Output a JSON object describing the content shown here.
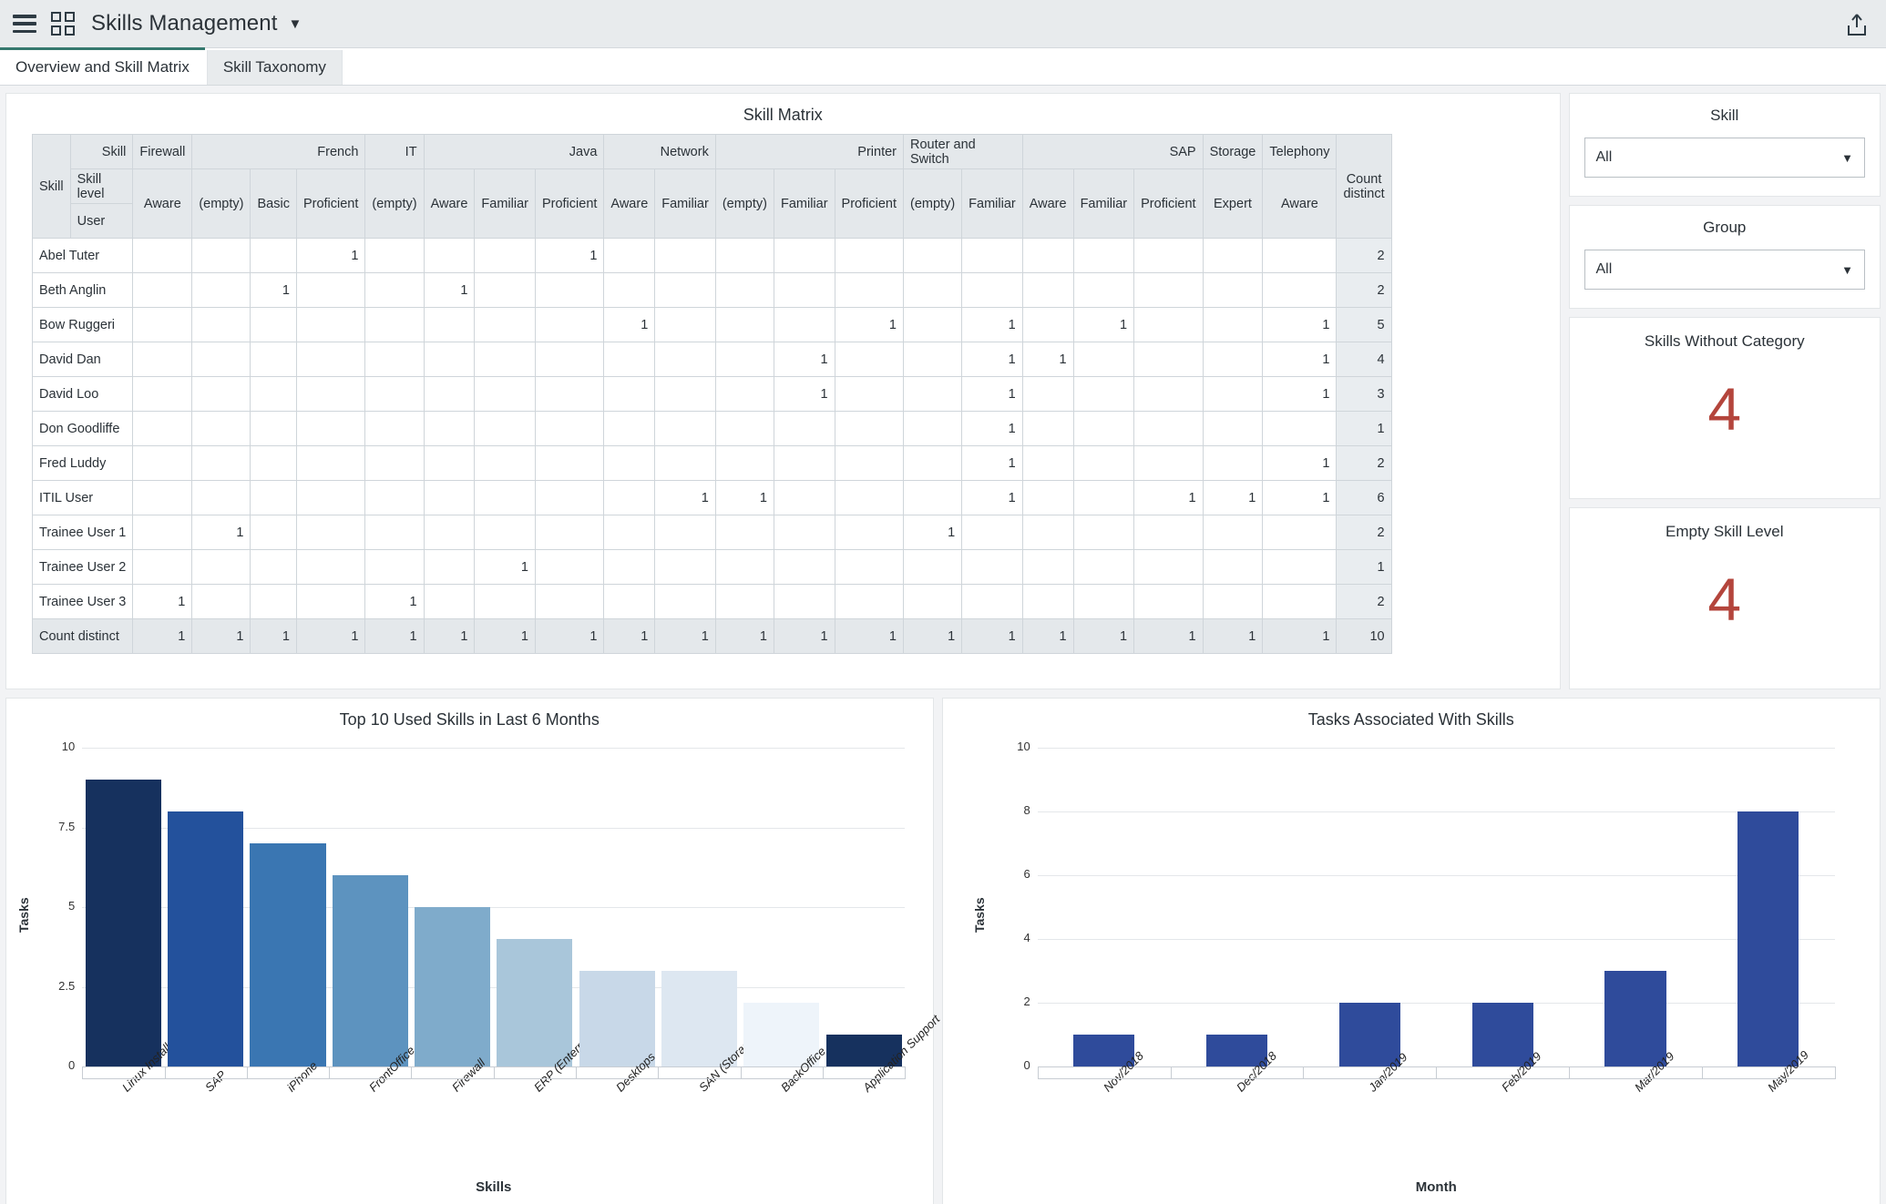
{
  "topbar": {
    "app_title": "Skills Management",
    "menu_icon": "hamburger-icon",
    "apps_icon": "grid-icon",
    "caret": "▼",
    "share_icon": "share-icon"
  },
  "tabs": [
    {
      "label": "Overview and Skill Matrix",
      "active": true
    },
    {
      "label": "Skill Taxonomy",
      "active": false
    }
  ],
  "matrix": {
    "title": "Skill Matrix",
    "corner_skill": "Skill",
    "corner_user": "User",
    "header_skill_label": "Skill",
    "header_level_label": "Skill level",
    "count_label": "Count distinct",
    "skill_groups": [
      {
        "name": "Firewall",
        "span": 1
      },
      {
        "name": "French",
        "span": 3
      },
      {
        "name": "IT",
        "span": 1
      },
      {
        "name": "Java",
        "span": 3
      },
      {
        "name": "Network",
        "span": 2
      },
      {
        "name": "Printer",
        "span": 3
      },
      {
        "name": "Router and Switch",
        "span": 2
      },
      {
        "name": "SAP",
        "span": 3
      },
      {
        "name": "Storage",
        "span": 1
      },
      {
        "name": "Telephony",
        "span": 1
      }
    ],
    "levels": [
      "Aware",
      "(empty)",
      "Basic",
      "Proficient",
      "(empty)",
      "Aware",
      "Familiar",
      "Proficient",
      "Aware",
      "Familiar",
      "(empty)",
      "Familiar",
      "Proficient",
      "(empty)",
      "Familiar",
      "Aware",
      "Familiar",
      "Proficient",
      "Expert",
      "Aware"
    ],
    "rows": [
      {
        "user": "Abel Tuter",
        "cells": [
          "",
          "",
          "",
          "1",
          "",
          "",
          "",
          "1",
          "",
          "",
          "",
          "",
          "",
          "",
          "",
          "",
          "",
          "",
          "",
          ""
        ],
        "count": "2"
      },
      {
        "user": "Beth Anglin",
        "cells": [
          "",
          "",
          "1",
          "",
          "",
          "1",
          "",
          "",
          "",
          "",
          "",
          "",
          "",
          "",
          "",
          "",
          "",
          "",
          "",
          ""
        ],
        "count": "2"
      },
      {
        "user": "Bow Ruggeri",
        "cells": [
          "",
          "",
          "",
          "",
          "",
          "",
          "",
          "",
          "1",
          "",
          "",
          "",
          "1",
          "",
          "1",
          "",
          "1",
          "",
          "",
          "1"
        ],
        "count": "5"
      },
      {
        "user": "David Dan",
        "cells": [
          "",
          "",
          "",
          "",
          "",
          "",
          "",
          "",
          "",
          "",
          "",
          "1",
          "",
          "",
          "1",
          "1",
          "",
          "",
          "",
          "1"
        ],
        "count": "4"
      },
      {
        "user": "David Loo",
        "cells": [
          "",
          "",
          "",
          "",
          "",
          "",
          "",
          "",
          "",
          "",
          "",
          "1",
          "",
          "",
          "1",
          "",
          "",
          "",
          "",
          "1"
        ],
        "count": "3"
      },
      {
        "user": "Don Goodliffe",
        "cells": [
          "",
          "",
          "",
          "",
          "",
          "",
          "",
          "",
          "",
          "",
          "",
          "",
          "",
          "",
          "1",
          "",
          "",
          "",
          "",
          ""
        ],
        "count": "1"
      },
      {
        "user": "Fred Luddy",
        "cells": [
          "",
          "",
          "",
          "",
          "",
          "",
          "",
          "",
          "",
          "",
          "",
          "",
          "",
          "",
          "1",
          "",
          "",
          "",
          "",
          "1"
        ],
        "count": "2"
      },
      {
        "user": "ITIL User",
        "cells": [
          "",
          "",
          "",
          "",
          "",
          "",
          "",
          "",
          "",
          "1",
          "1",
          "",
          "",
          "",
          "1",
          "",
          "",
          "1",
          "1",
          "1"
        ],
        "count": "6"
      },
      {
        "user": "Trainee User 1",
        "cells": [
          "",
          "1",
          "",
          "",
          "",
          "",
          "",
          "",
          "",
          "",
          "",
          "",
          "",
          "1",
          "",
          "",
          "",
          "",
          "",
          ""
        ],
        "count": "2"
      },
      {
        "user": "Trainee User 2",
        "cells": [
          "",
          "",
          "",
          "",
          "",
          "",
          "1",
          "",
          "",
          "",
          "",
          "",
          "",
          "",
          "",
          "",
          "",
          "",
          "",
          ""
        ],
        "count": "1"
      },
      {
        "user": "Trainee User 3",
        "cells": [
          "1",
          "",
          "",
          "",
          "1",
          "",
          "",
          "",
          "",
          "",
          "",
          "",
          "",
          "",
          "",
          "",
          "",
          "",
          "",
          ""
        ],
        "count": "2"
      }
    ],
    "totals": {
      "user": "Count distinct",
      "cells": [
        "1",
        "1",
        "1",
        "1",
        "1",
        "1",
        "1",
        "1",
        "1",
        "1",
        "1",
        "1",
        "1",
        "1",
        "1",
        "1",
        "1",
        "1",
        "1",
        "1"
      ],
      "count": "10"
    }
  },
  "filters": [
    {
      "title": "Skill",
      "value": "All",
      "caret": "▼"
    },
    {
      "title": "Group",
      "value": "All",
      "caret": "▼"
    }
  ],
  "kpis": [
    {
      "title": "Skills Without Category",
      "value": "4",
      "color": "#b4453c"
    },
    {
      "title": "Empty Skill Level",
      "value": "4",
      "color": "#b4453c"
    }
  ],
  "chart_data": [
    {
      "type": "bar",
      "title": "Top 10 Used Skills in Last 6 Months",
      "xlabel": "Skills",
      "ylabel": "Tasks",
      "categories": [
        "Linux Installatio...",
        "SAP",
        "iPhone",
        "FrontOffice skill",
        "Firewall",
        "ERP (Enterprise r...",
        "Desktops",
        "SAN (Storage Area...",
        "BackOffice",
        "Application Support"
      ],
      "values": [
        9,
        8,
        7,
        6,
        5,
        4,
        3,
        3,
        2,
        1
      ],
      "colors": [
        "#16315e",
        "#23519c",
        "#3a76b2",
        "#5d93bf",
        "#7fabcb",
        "#a9c6da",
        "#c8d8e8",
        "#dde7f1",
        "#eef4fa",
        "#16315e"
      ],
      "ylim": [
        0,
        10
      ],
      "yticks": [
        "0",
        "2.5",
        "5",
        "7.5",
        "10"
      ],
      "grid": true,
      "legend": "none"
    },
    {
      "type": "bar",
      "title": "Tasks Associated With Skills",
      "xlabel": "Month",
      "ylabel": "Tasks",
      "categories": [
        "Nov/2018",
        "Dec/2018",
        "Jan/2019",
        "Feb/2019",
        "Mar/2019",
        "May/2019"
      ],
      "values": [
        1,
        1,
        2,
        2,
        3,
        8
      ],
      "colors": [
        "#2f4b9b",
        "#2f4b9b",
        "#2f4b9b",
        "#2f4b9b",
        "#2f4b9b",
        "#2f4b9b"
      ],
      "ylim": [
        0,
        10
      ],
      "yticks": [
        "0",
        "2",
        "4",
        "6",
        "8",
        "10"
      ],
      "grid": true,
      "legend": "none"
    }
  ]
}
